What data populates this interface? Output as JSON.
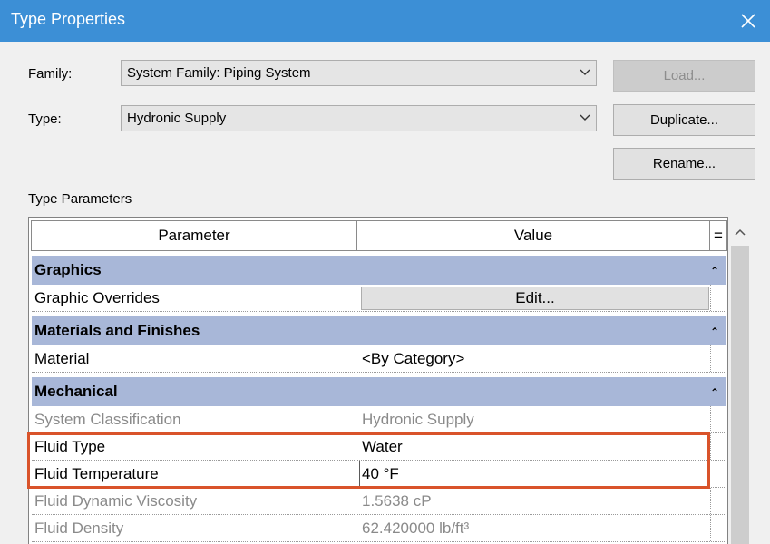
{
  "window": {
    "title": "Type Properties"
  },
  "family": {
    "label": "Family:",
    "value": "System Family: Piping System"
  },
  "type": {
    "label": "Type:",
    "value": "Hydronic Supply"
  },
  "buttons": {
    "load": "Load...",
    "duplicate": "Duplicate...",
    "rename": "Rename..."
  },
  "type_parameters_label": "Type Parameters",
  "table": {
    "col_parameter": "Parameter",
    "col_value": "Value",
    "col_sort": "="
  },
  "groups": {
    "graphics": "Graphics",
    "materials": "Materials and Finishes",
    "mechanical": "Mechanical"
  },
  "rows": {
    "graphic_overrides": {
      "name": "Graphic Overrides",
      "value": "Edit..."
    },
    "material": {
      "name": "Material",
      "value": "<By Category>"
    },
    "system_classification": {
      "name": "System Classification",
      "value": "Hydronic Supply"
    },
    "fluid_type": {
      "name": "Fluid Type",
      "value": "Water"
    },
    "fluid_temperature": {
      "name": "Fluid Temperature",
      "value": "40 °F"
    },
    "fluid_viscosity": {
      "name": "Fluid Dynamic Viscosity",
      "value": "1.5638 cP"
    },
    "fluid_density": {
      "name": "Fluid Density",
      "value": "62.420000 lb/ft³"
    }
  },
  "colors": {
    "titlebar": "#3c8fd6",
    "group_header": "#a8b7d8",
    "highlight": "#d9532a"
  }
}
